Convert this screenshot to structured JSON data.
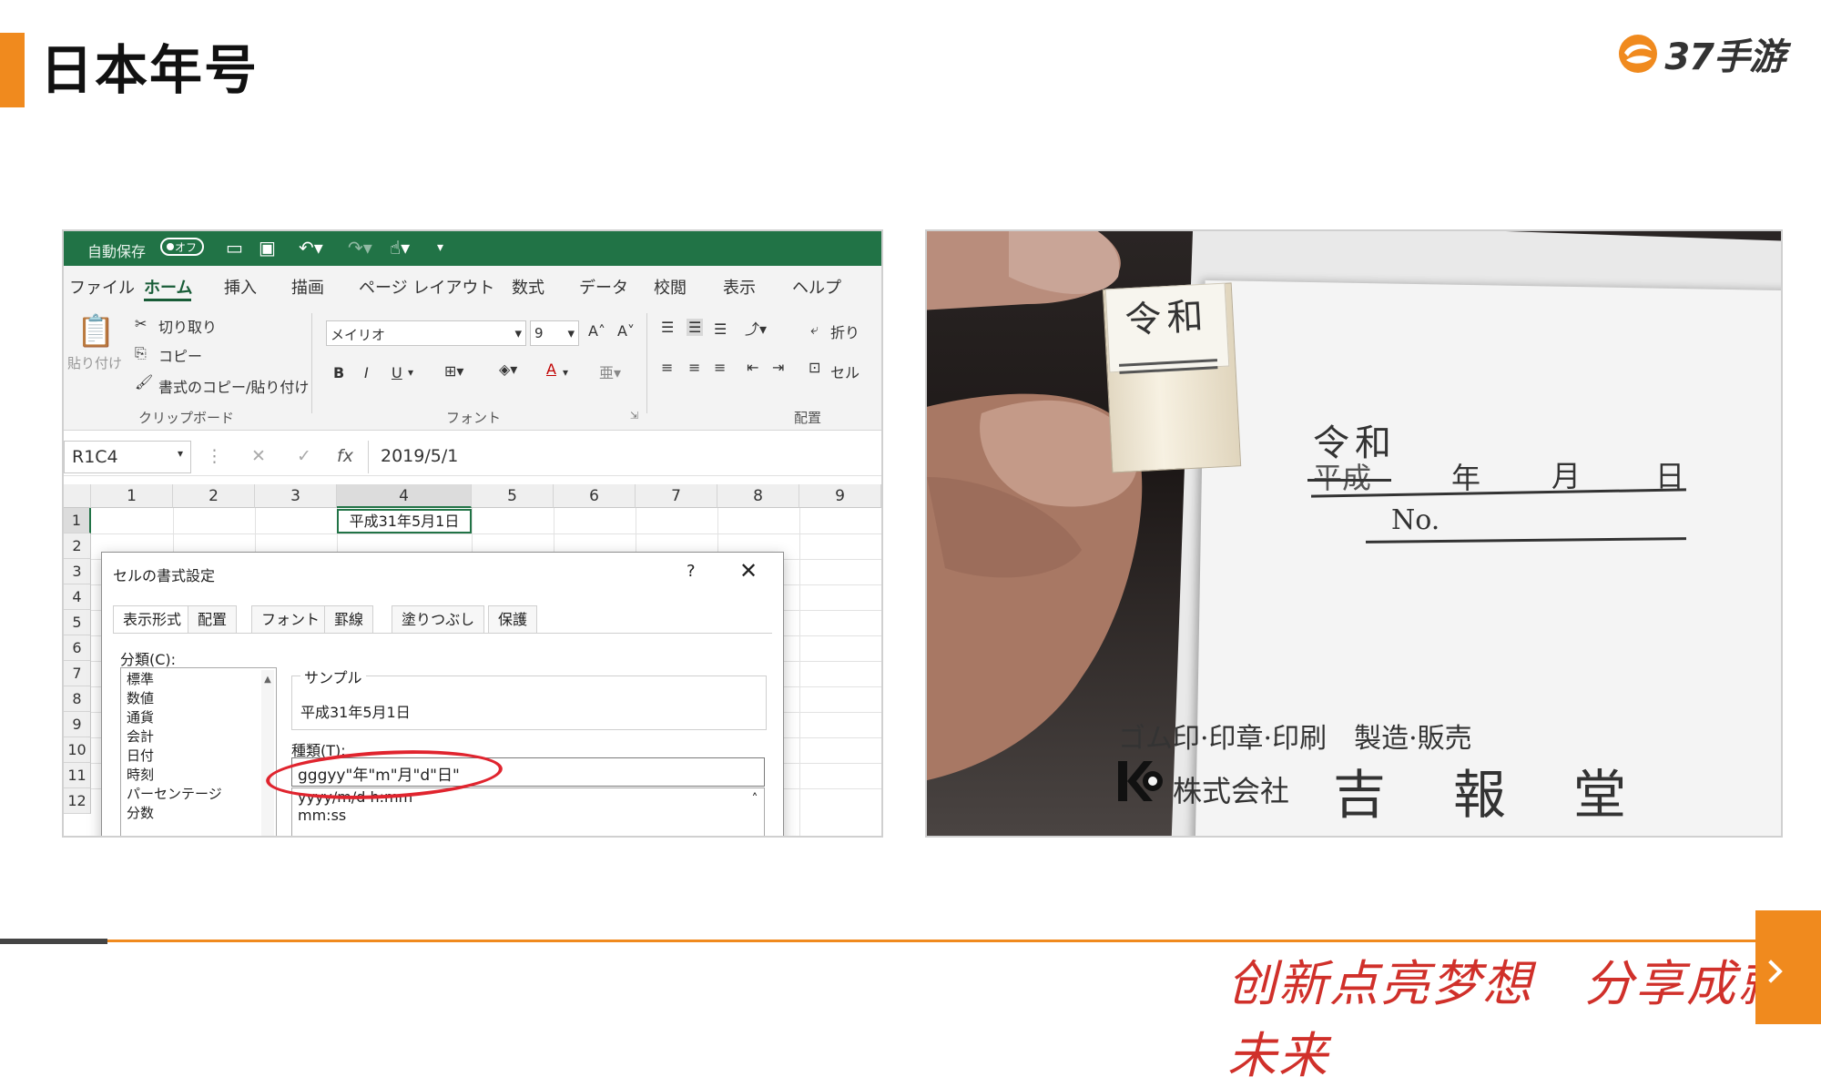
{
  "slide": {
    "title": "日本年号",
    "brand": "37手游",
    "slogan": "创新点亮梦想　分享成就未来"
  },
  "excel": {
    "qat": {
      "autosave": "自動保存",
      "toggle": "オフ"
    },
    "tabs": [
      "ファイル",
      "ホーム",
      "挿入",
      "描画",
      "ページ レイアウト",
      "数式",
      "データ",
      "校閲",
      "表示",
      "ヘルプ"
    ],
    "clipboard": {
      "paste": "貼り付け",
      "cut": "切り取り",
      "copy": "コピー",
      "format_painter": "書式のコピー/貼り付け",
      "group": "クリップボード"
    },
    "font": {
      "name": "メイリオ",
      "size": "9",
      "bold": "B",
      "italic": "I",
      "underline": "U",
      "grow": "A˄",
      "shrink": "A˅",
      "color": "A",
      "group": "フォント"
    },
    "alignment": {
      "wrap": "折り",
      "merge": "セル",
      "group": "配置"
    },
    "formula_bar": {
      "name_box": "R1C4",
      "fx": "fx",
      "cancel": "✕",
      "enter": "✓",
      "value": "2019/5/1"
    },
    "columns": [
      "1",
      "2",
      "3",
      "4",
      "5",
      "6",
      "7",
      "8",
      "9"
    ],
    "rows": [
      "1",
      "2",
      "3",
      "4",
      "5",
      "6",
      "7",
      "8",
      "9",
      "10",
      "11",
      "12"
    ],
    "active_cell_value": "平成31年5月1日",
    "dialog": {
      "title": "セルの書式設定",
      "help": "?",
      "close": "✕",
      "tabs": [
        "表示形式",
        "配置",
        "フォント",
        "罫線",
        "塗りつぶし",
        "保護"
      ],
      "category_label": "分類(C):",
      "categories": [
        "標準",
        "数値",
        "通貨",
        "会計",
        "日付",
        "時刻",
        "パーセンテージ",
        "分数"
      ],
      "sample_label": "サンプル",
      "sample_value": "平成31年5月1日",
      "type_label": "種類(T):",
      "type_value": "gggyy\"年\"m\"月\"d\"日\"",
      "type_list": [
        "yyyy/m/d h:mm",
        "mm:ss"
      ]
    }
  },
  "photo": {
    "stamp_text": "令和",
    "form_era_new": "令和",
    "form_era_old": "平成",
    "year": "年",
    "month": "月",
    "day": "日",
    "no": "No.",
    "maker_line": "ゴム印·印章·印刷　製造·販売",
    "company_prefix": "株式会社",
    "company_name": [
      "吉",
      "報",
      "堂"
    ]
  },
  "colors": {
    "accent": "#f08a1e",
    "excel_green": "#217346",
    "highlight_red": "#e0242e",
    "slogan_red": "#d0302a"
  }
}
